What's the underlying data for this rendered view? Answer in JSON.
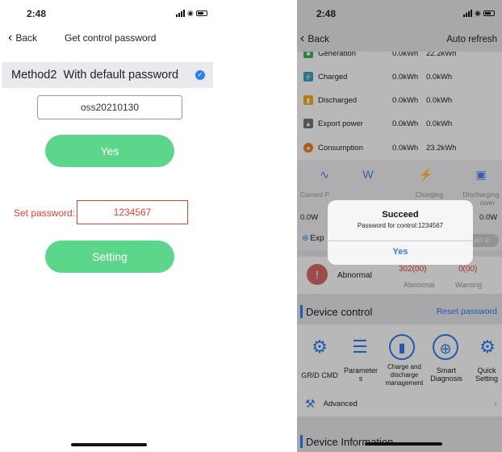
{
  "left": {
    "status_time": "2:48",
    "back_label": "Back",
    "title": "Get control password",
    "method_label": "Method2",
    "method_desc": "With default password",
    "default_password": "oss20210130",
    "yes_label": "Yes",
    "set_password_label": "Set password:",
    "set_password_value": "1234567",
    "setting_label": "Setting"
  },
  "right": {
    "status_time": "2:48",
    "back_label": "Back",
    "auto_refresh": "Auto refresh",
    "energy_rows": [
      {
        "name": "Generation",
        "v1": "0.0kWh",
        "v2": "22.2kWh",
        "icon": "generation-icon",
        "color": "#3cb45a"
      },
      {
        "name": "Charged",
        "v1": "0.0kWh",
        "v2": "0.0kWh",
        "icon": "battery-charge-icon",
        "color": "#2fa3e0"
      },
      {
        "name": "Discharged",
        "v1": "0.0kWh",
        "v2": "0.0kWh",
        "icon": "battery-discharge-icon",
        "color": "#f0b020"
      },
      {
        "name": "Export power",
        "v1": "0.0kWh",
        "v2": "0.0kWh",
        "icon": "tower-icon",
        "color": "#555555"
      },
      {
        "name": "Consumption",
        "v1": "0.0kWh",
        "v2": "23.2kWh",
        "icon": "fire-icon",
        "color": "#f08020"
      }
    ],
    "stat_labels": [
      "Current P",
      "Charging",
      "Discharging"
    ],
    "stat_label_extra": "ower",
    "stat_values": [
      "0.0W",
      "0.0W"
    ],
    "export_label": "Exp",
    "toggle_label": "act",
    "abnormal_label": "Abnormal",
    "abnormal_count": "302(00)",
    "abnormal_sub": "Abnormal",
    "warning_count": "0(00)",
    "warning_sub": "Warning",
    "device_control": "Device control",
    "reset_password": "Reset password",
    "controls": [
      {
        "label": "GRID CMD",
        "icon": "gears-icon"
      },
      {
        "label": "Parameter\ns",
        "icon": "sliders-icon"
      },
      {
        "label": "Charge and\ndischarge\nmanagement",
        "icon": "battery-cycle-icon"
      },
      {
        "label": "Smart\nDiagnosis",
        "icon": "target-icon"
      },
      {
        "label": "Quick\nSetting",
        "icon": "quick-gear-icon"
      }
    ],
    "advanced_label": "Advanced",
    "device_information": "Device Information",
    "dialog": {
      "title": "Succeed",
      "message": "Password for control:1234567",
      "button": "Yes"
    }
  },
  "colors": {
    "accent": "#2f7ef0",
    "green_button": "#5cd68a",
    "error_red": "#dd4433"
  }
}
